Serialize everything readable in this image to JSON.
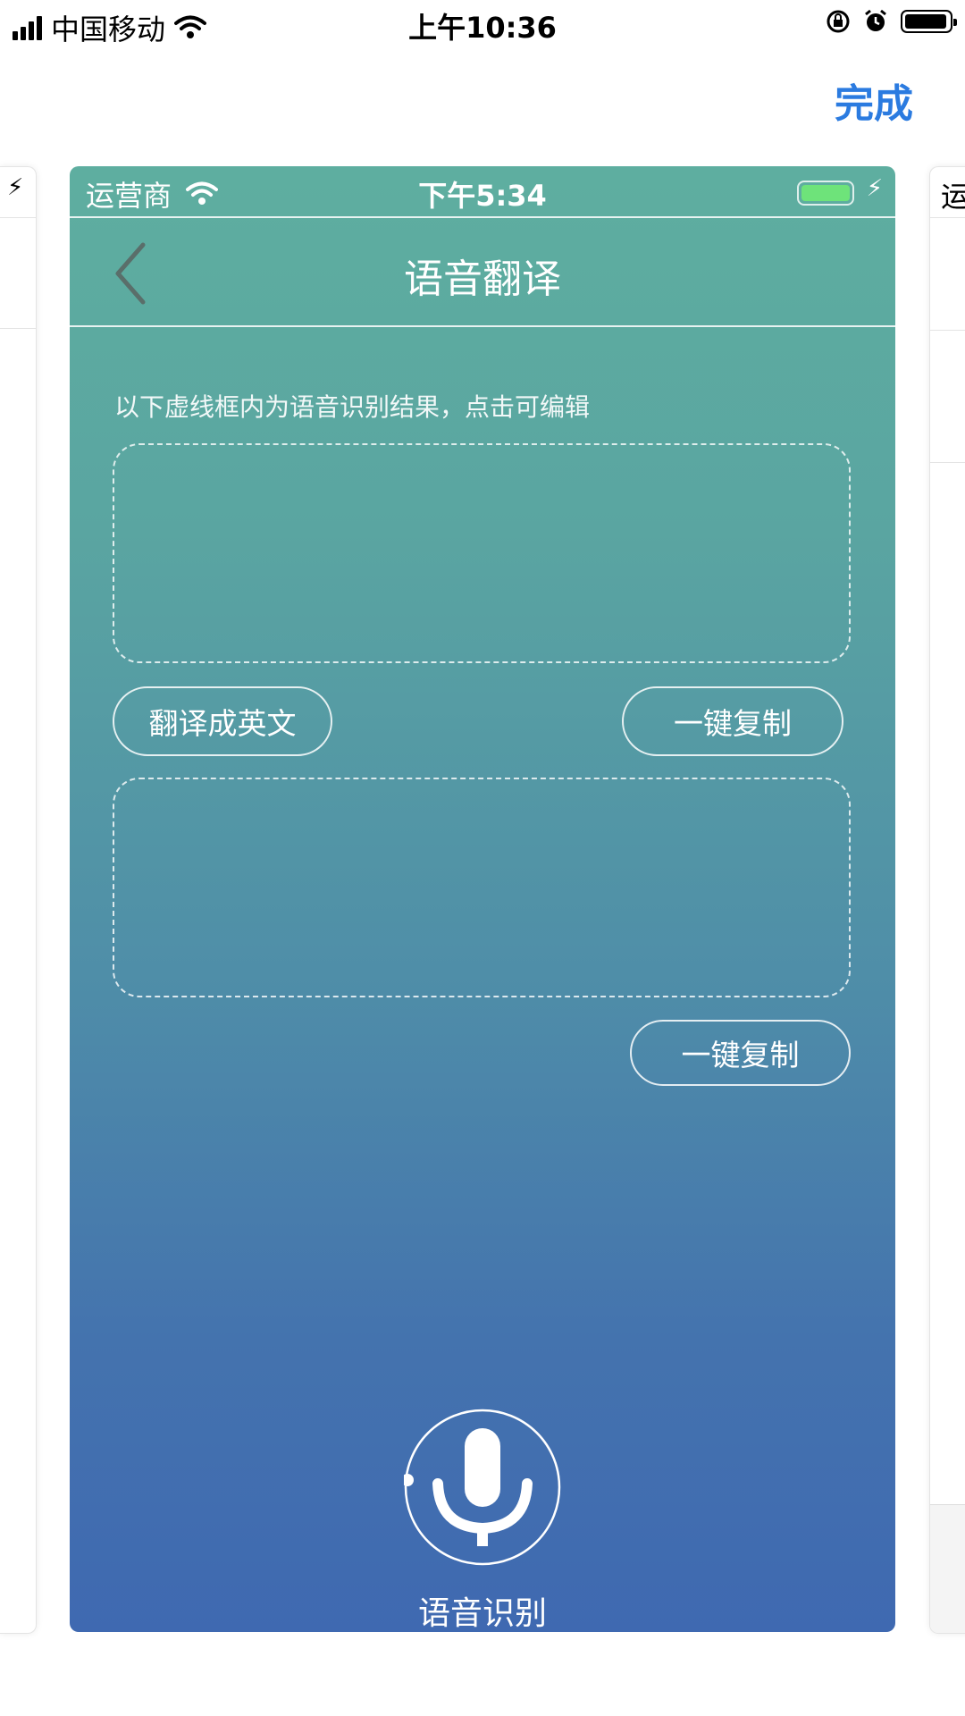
{
  "status_bar": {
    "carrier": "中国移动",
    "time": "上午10:36"
  },
  "top_actions": {
    "done_label": "完成"
  },
  "peek_right": {
    "text": "运"
  },
  "inner_screen": {
    "status": {
      "carrier": "运营商",
      "time": "下午5:34",
      "battery_color": "#6ee37a"
    },
    "nav": {
      "title": "语音翻译"
    },
    "hint": "以下虚线框内为语音识别结果，点击可编辑",
    "translate_button": "翻译成英文",
    "copy_button_1": "一键复制",
    "copy_button_2": "一键复制",
    "mic_caption": "语音识别"
  },
  "colors": {
    "accent": "#2b7be0",
    "gradient_top": "#5eaea0",
    "gradient_bottom": "#3f69b1"
  }
}
